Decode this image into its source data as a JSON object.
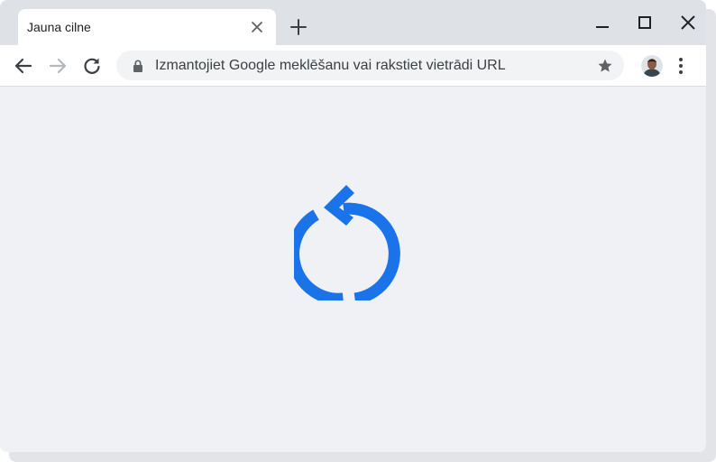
{
  "tab": {
    "title": "Jauna cilne",
    "close_icon": "close-icon"
  },
  "tabstrip": {
    "new_tab_icon": "plus-icon"
  },
  "window_controls": {
    "minimize_icon": "minimize-icon",
    "maximize_icon": "maximize-icon",
    "close_icon": "close-icon"
  },
  "toolbar": {
    "back_icon": "arrow-left-icon",
    "forward_icon": "arrow-right-icon",
    "reload_icon": "reload-icon",
    "menu_icon": "three-dots-icon"
  },
  "omnibox": {
    "placeholder": "Izmantojiet Google meklēšanu vai rakstiet vietrādi URL",
    "lock_icon": "lock-icon",
    "bookmark_icon": "star-icon"
  },
  "content": {
    "graphic_icon": "reload-icon"
  },
  "colors": {
    "accent": "#1a73e8",
    "tabstrip": "#dee1e6",
    "page_background": "#f0f1f4",
    "omnibox_background": "#f1f3f4"
  }
}
